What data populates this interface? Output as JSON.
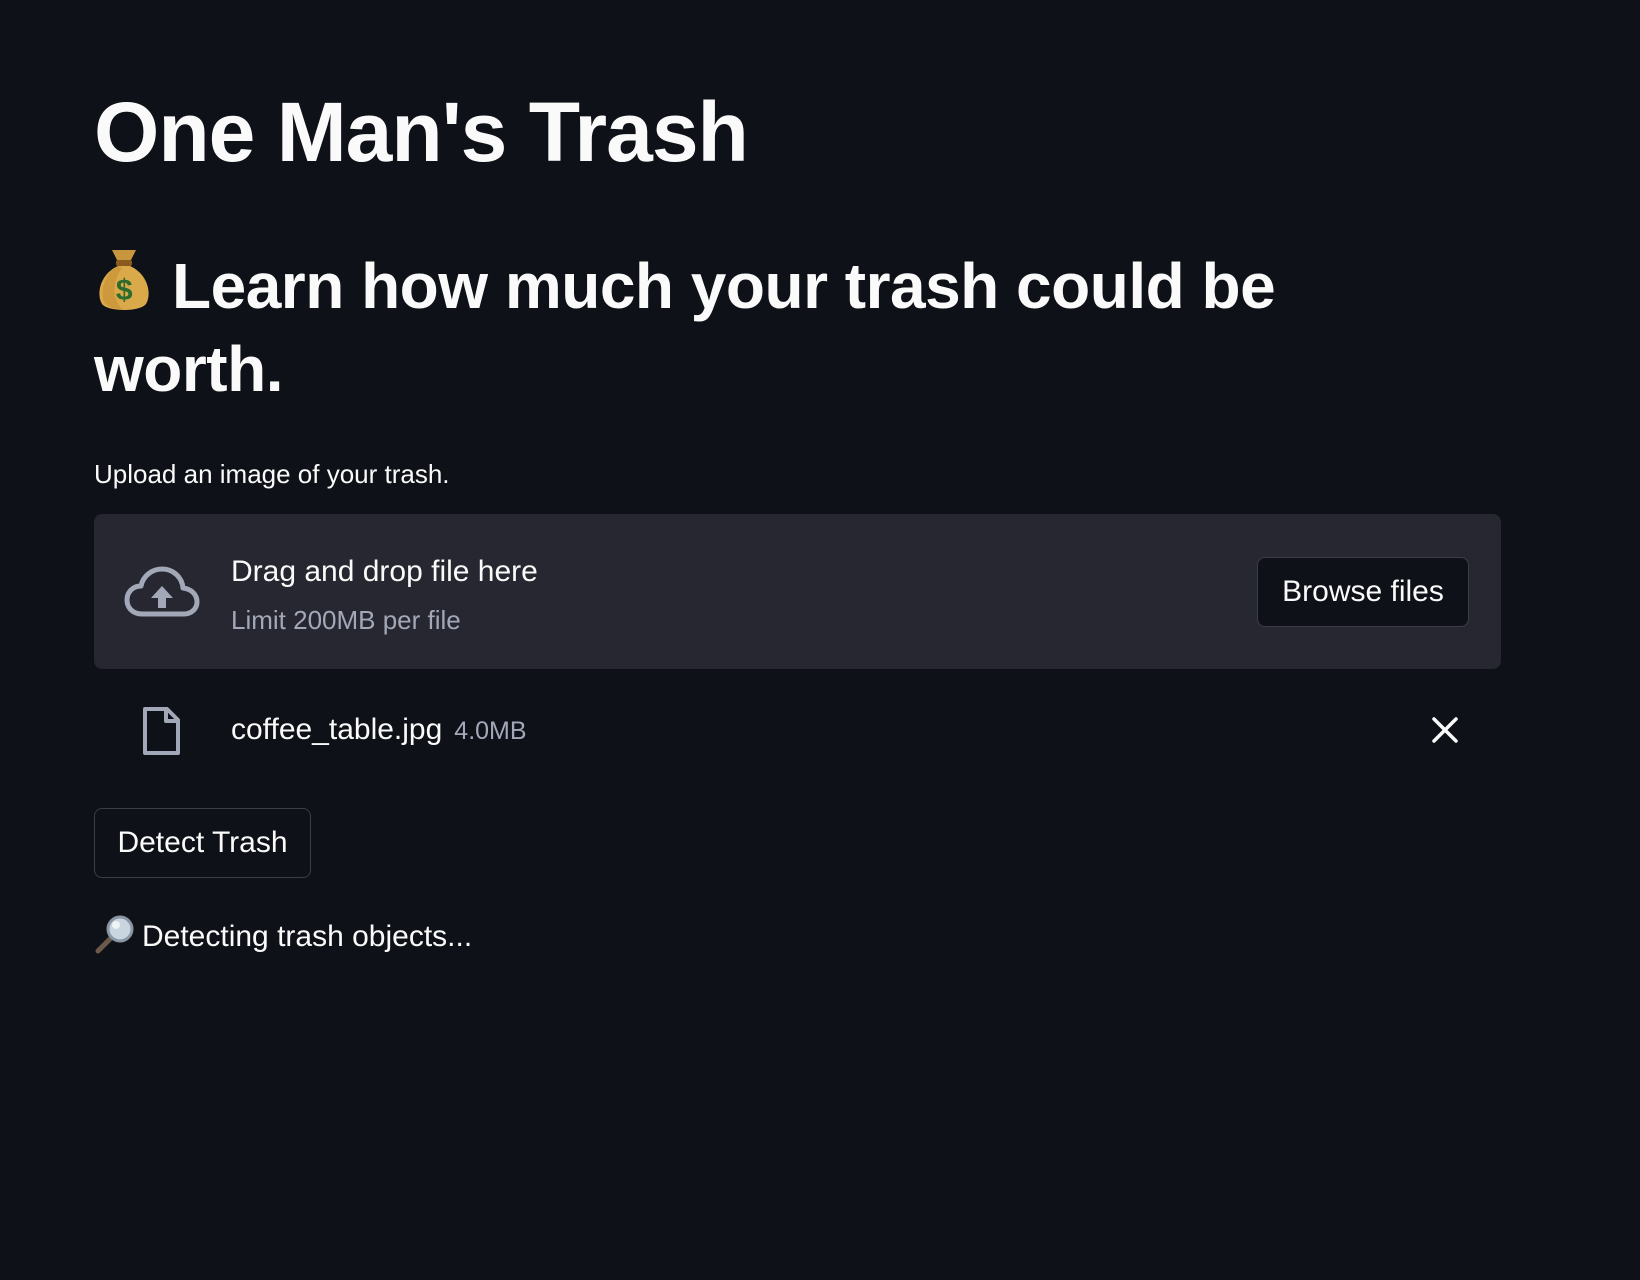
{
  "app": {
    "title": "One Man's Trash",
    "subheader": "Learn how much your trash could be worth.",
    "subheader_icon": "money-bag-icon"
  },
  "uploader": {
    "label": "Upload an image of your trash.",
    "drop_text": "Drag and drop file here",
    "limit_text": "Limit 200MB per file",
    "browse_label": "Browse files",
    "icon": "cloud-upload-icon"
  },
  "uploaded_file": {
    "name": "coffee_table.jpg",
    "size": "4.0MB",
    "icon": "file-icon",
    "remove_icon": "close-icon"
  },
  "actions": {
    "detect_label": "Detect Trash"
  },
  "status": {
    "text": "Detecting trash objects...",
    "icon": "magnifier-icon"
  },
  "colors": {
    "background": "#0e1117",
    "panel": "#262730",
    "text": "#fafafa",
    "muted": "#a3a8b8"
  }
}
